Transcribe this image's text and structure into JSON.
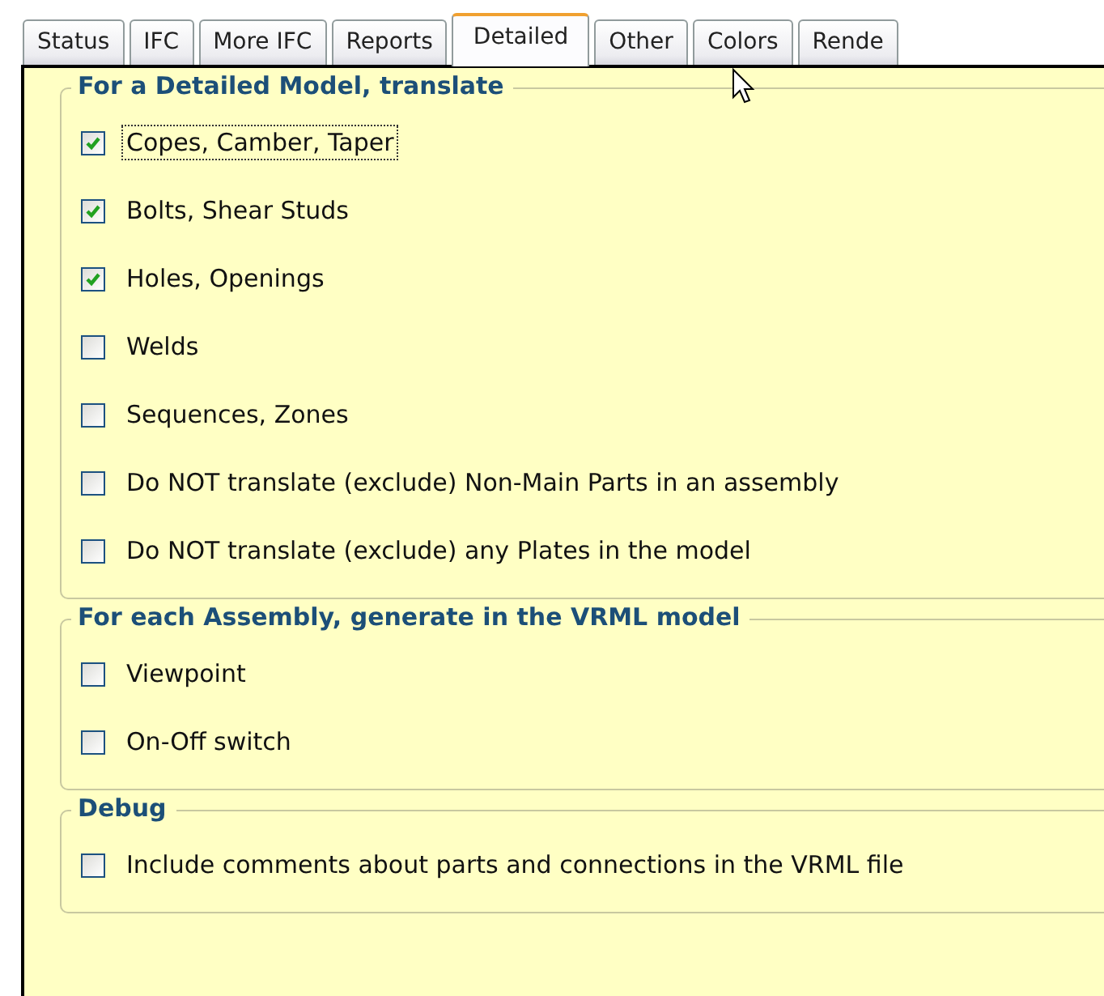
{
  "tabs": [
    {
      "label": "Status",
      "selected": false
    },
    {
      "label": "IFC",
      "selected": false
    },
    {
      "label": "More IFC",
      "selected": false
    },
    {
      "label": "Reports",
      "selected": false
    },
    {
      "label": "Detailed",
      "selected": true
    },
    {
      "label": "Other",
      "selected": false
    },
    {
      "label": "Colors",
      "selected": false
    },
    {
      "label": "Rende",
      "selected": false
    }
  ],
  "groups": [
    {
      "title": "For a Detailed Model, translate",
      "options": [
        {
          "label": "Copes, Camber, Taper",
          "checked": true,
          "focused": true
        },
        {
          "label": "Bolts, Shear Studs",
          "checked": true,
          "focused": false
        },
        {
          "label": "Holes, Openings",
          "checked": true,
          "focused": false
        },
        {
          "label": "Welds",
          "checked": false,
          "focused": false
        },
        {
          "label": "Sequences, Zones",
          "checked": false,
          "focused": false
        },
        {
          "label": "Do NOT translate (exclude) Non-Main Parts in an assembly",
          "checked": false,
          "focused": false
        },
        {
          "label": "Do NOT translate (exclude) any Plates in the model",
          "checked": false,
          "focused": false
        }
      ]
    },
    {
      "title": "For each Assembly, generate in the VRML model",
      "options": [
        {
          "label": "Viewpoint",
          "checked": false,
          "focused": false
        },
        {
          "label": "On-Off switch",
          "checked": false,
          "focused": false
        }
      ]
    },
    {
      "title": "Debug",
      "options": [
        {
          "label": "Include comments about parts and connections in the VRML file",
          "checked": false,
          "focused": false
        }
      ]
    }
  ]
}
